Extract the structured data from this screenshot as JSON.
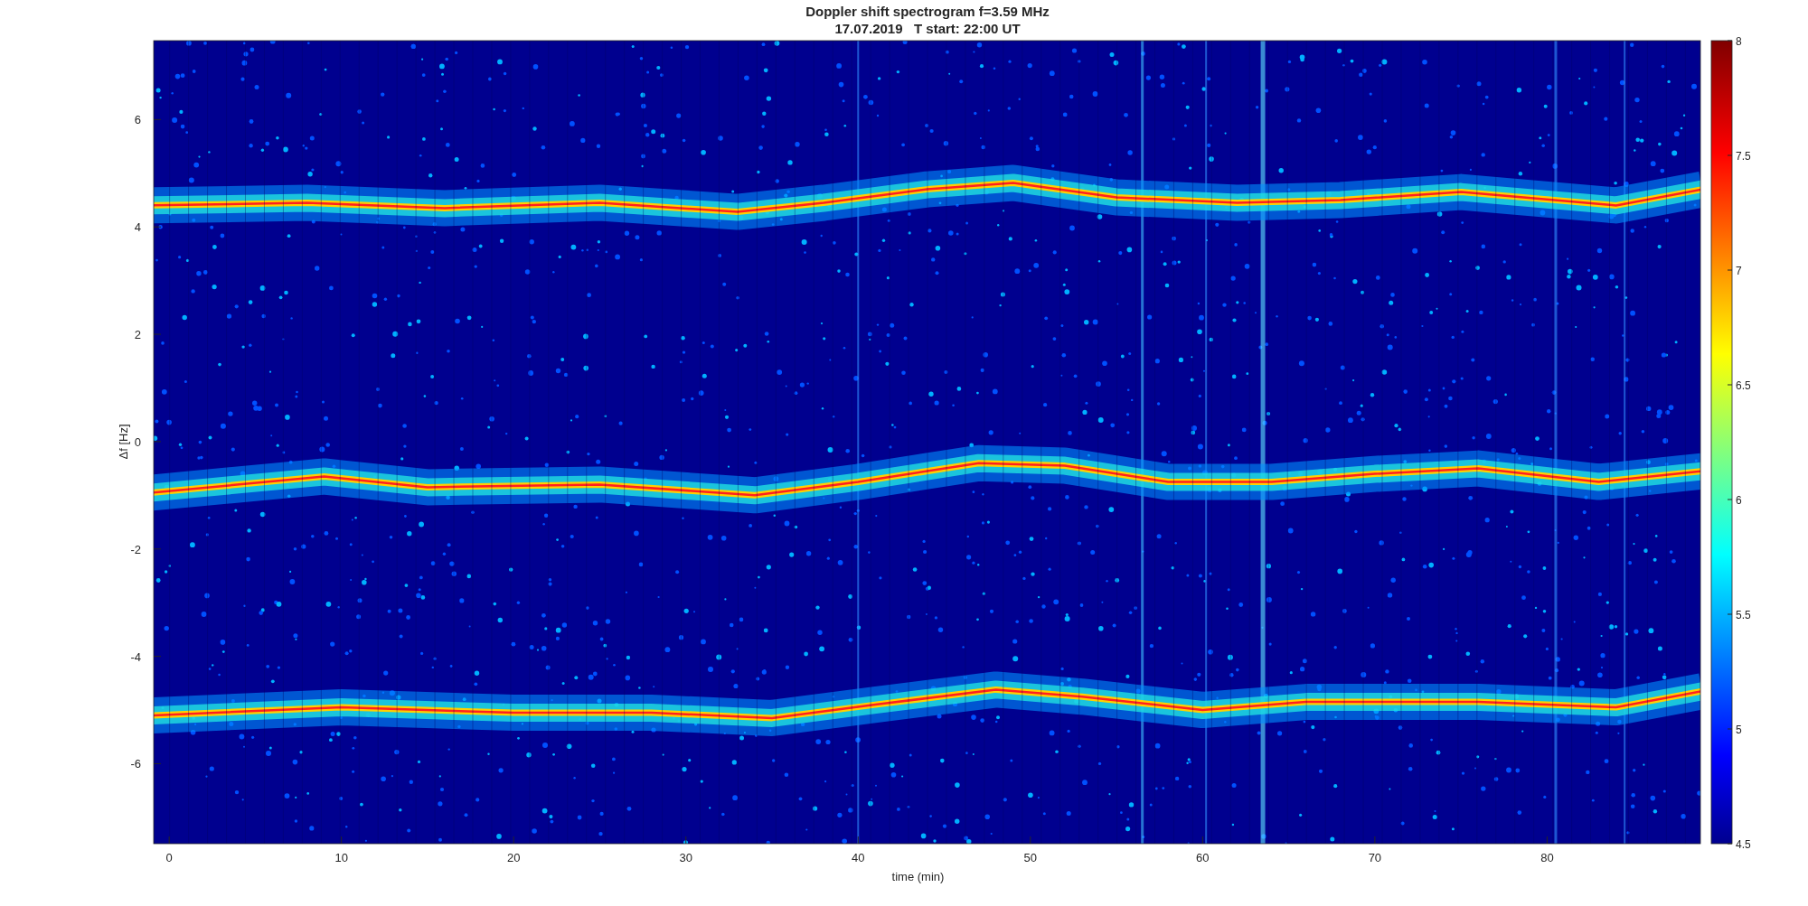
{
  "title": [
    "Doppler shift spectrogram f=3.59 MHz",
    "17.07.2019   T start: 22:00 UT"
  ],
  "x_axis": {
    "label": "time (min)",
    "ticks": [
      "0",
      "10",
      "20",
      "30",
      "40",
      "50",
      "60",
      "70",
      "80"
    ]
  },
  "y_axis": {
    "label": "Δf [Hz]",
    "ticks": [
      "6",
      "4",
      "2",
      "0",
      "-2",
      "-4",
      "-6"
    ]
  },
  "colorbar": {
    "ticks": [
      "8",
      "7.5",
      "7",
      "6.5",
      "6",
      "5.5",
      "5",
      "4.5"
    ]
  }
}
